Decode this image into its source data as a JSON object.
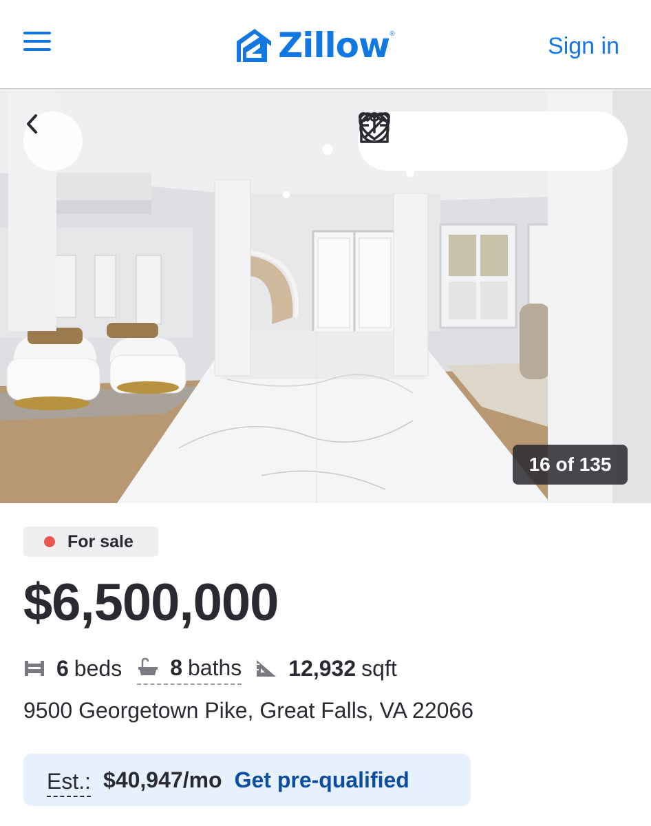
{
  "header": {
    "logo_text": "Zillow",
    "logo_mark": "®",
    "sign_in_label": "Sign in"
  },
  "gallery": {
    "counter": "16 of 135",
    "actions": [
      "heart-icon",
      "share-icon",
      "hide-icon",
      "more-icon"
    ]
  },
  "listing": {
    "status": "For sale",
    "price": "$6,500,000",
    "beds_value": "6",
    "beds_label": "beds",
    "baths_value": "8",
    "baths_label": "baths",
    "sqft_value": "12,932",
    "sqft_label": "sqft",
    "address": "9500 Georgetown Pike, Great Falls, VA 22066"
  },
  "estimate": {
    "label": "Est.:",
    "amount": "$40,947/mo",
    "cta": "Get pre-qualified"
  },
  "colors": {
    "brand": "#1277e1",
    "status_dot": "#e8574d",
    "cta_text": "#0d4da0",
    "est_bg": "#e6f1fd"
  }
}
